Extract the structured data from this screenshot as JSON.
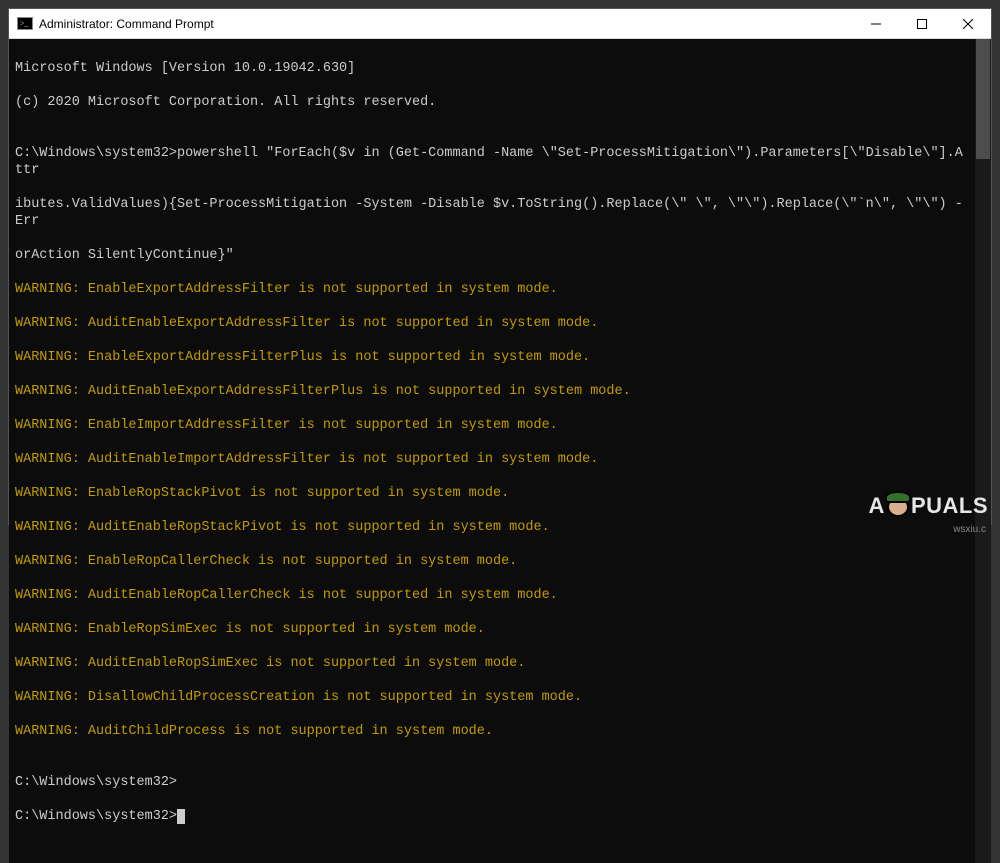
{
  "window": {
    "title": "Administrator: Command Prompt"
  },
  "header1": "Microsoft Windows [Version 10.0.19042.630]",
  "header2": "(c) 2020 Microsoft Corporation. All rights reserved.",
  "blank": "",
  "promptPath": "C:\\Windows\\system32>",
  "command1": "powershell \"ForEach($v in (Get-Command -Name \\\"Set-ProcessMitigation\\\").Parameters[\\\"Disable\\\"].Attr",
  "command2": "ibutes.ValidValues){Set-ProcessMitigation -System -Disable $v.ToString().Replace(\\\" \\\", \\\"\\\").Replace(\\\"`n\\\", \\\"\\\") -Err",
  "command3": "orAction SilentlyContinue}\"",
  "warnings": [
    "WARNING: EnableExportAddressFilter is not supported in system mode.",
    "WARNING: AuditEnableExportAddressFilter is not supported in system mode.",
    "WARNING: EnableExportAddressFilterPlus is not supported in system mode.",
    "WARNING: AuditEnableExportAddressFilterPlus is not supported in system mode.",
    "WARNING: EnableImportAddressFilter is not supported in system mode.",
    "WARNING: AuditEnableImportAddressFilter is not supported in system mode.",
    "WARNING: EnableRopStackPivot is not supported in system mode.",
    "WARNING: AuditEnableRopStackPivot is not supported in system mode.",
    "WARNING: EnableRopCallerCheck is not supported in system mode.",
    "WARNING: AuditEnableRopCallerCheck is not supported in system mode.",
    "WARNING: EnableRopSimExec is not supported in system mode.",
    "WARNING: AuditEnableRopSimExec is not supported in system mode.",
    "WARNING: DisallowChildProcessCreation is not supported in system mode.",
    "WARNING: AuditChildProcess is not supported in system mode."
  ],
  "watermark": {
    "pre": "A",
    "post": "PUALS"
  },
  "wsxiu": "wsxiu.c"
}
